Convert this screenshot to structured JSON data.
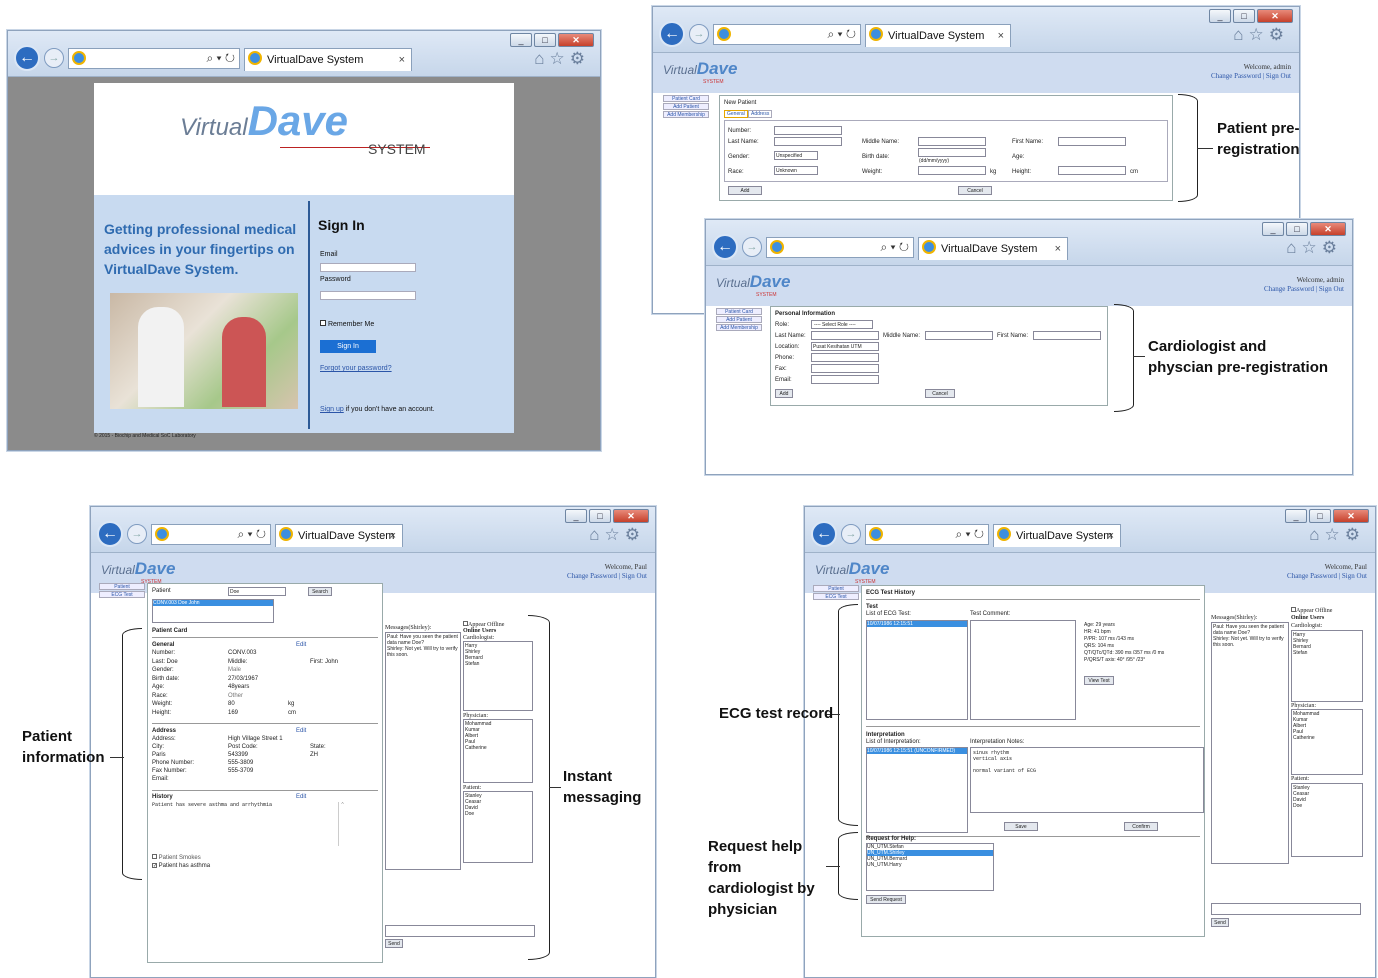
{
  "browser": {
    "tab_title": "VirtualDave System",
    "tab_close": "×",
    "search_glyph": "⌕ ▾ ↻"
  },
  "login": {
    "logo_virtual": "Virtual",
    "logo_dave": "Dave",
    "logo_system": "SYSTEM",
    "tagline": "Getting professional medical advices in your fingertips on VirtualDave System.",
    "signin_title": "Sign In",
    "email_label": "Email",
    "password_label": "Password",
    "remember_label": "Remember Me",
    "signin_button": "Sign In",
    "forgot_link": "Forgot your password?",
    "signup_link": "Sign up",
    "signup_text": "if you don't have an account.",
    "footer": "© 2015 - Biochip and Medical SoC Laboratory"
  },
  "header": {
    "welcome_admin": "Welcome, admin",
    "welcome_paul": "Welcome, Paul",
    "links": "Change Password | Sign Out"
  },
  "patient_reg": {
    "side": [
      "Patient Card",
      "Add Patient",
      "Add Membership"
    ],
    "title": "New Patient",
    "tabs": [
      "General",
      "Address"
    ],
    "number": "Number:",
    "last_name": "Last Name:",
    "middle_name": "Middle Name:",
    "first_name": "First Name:",
    "gender": "Gender:",
    "gender_val": "Unspecified",
    "birth": "Birth date:",
    "birth_hint": "(dd/mm/yyyy)",
    "age": "Age:",
    "race": "Race:",
    "race_val": "Unknown",
    "weight": "Weight:",
    "kg": "kg",
    "height": "Height:",
    "cm": "cm",
    "add": "Add",
    "cancel": "Cancel"
  },
  "doctor_reg": {
    "title": "Personal Information",
    "role": "Role:",
    "role_val": "---- Select Role ----",
    "last_name": "Last Name:",
    "middle_name": "Middle Name:",
    "first_name": "First Name:",
    "location": "Location:",
    "location_val": "Pusat Kesihatan UTM",
    "phone": "Phone:",
    "fax": "Fax:",
    "email": "Email:",
    "add": "Add",
    "cancel": "Cancel"
  },
  "patient_card": {
    "side": [
      "Patient",
      "ECG Test"
    ],
    "patient_label": "Patient",
    "patient_val": "Doe",
    "search": "Search",
    "result": "CONV.003 Doe John",
    "title": "Patient Card",
    "general": "General",
    "edit": "Edit",
    "rows": [
      [
        "Number:",
        "CONV.003"
      ],
      [
        "Last: Doe",
        "Middle:"
      ],
      [
        "Gender:",
        "Male"
      ],
      [
        "Birth date:",
        "27/03/1967"
      ],
      [
        "Age:",
        "48years"
      ],
      [
        "Race:",
        "Other"
      ],
      [
        "Weight:",
        "80"
      ],
      [
        "Height:",
        "169"
      ]
    ],
    "first": "First: John",
    "kg": "kg",
    "cm": "cm",
    "address": "Address",
    "addr_rows": [
      [
        "Address:",
        "High Village Street 1"
      ],
      [
        "City:",
        "Post Code:"
      ],
      [
        "Paris",
        "543399"
      ],
      [
        "Phone Number:",
        "555-3809"
      ],
      [
        "Fax Number:",
        "555-3709"
      ],
      [
        "Email:",
        ""
      ]
    ],
    "state": "State:",
    "state_val": "ZH",
    "history": "History",
    "history_text": "Patient has severe asthma and arrhythmia",
    "smokes": "Patient Smokes",
    "asthma": "Patient has asthma"
  },
  "messaging": {
    "messages_title": "Messages(Shirley):",
    "msg1": "Paul: Have you seen the patient data name Doe?",
    "msg2": "Shirley: Not yet. Will try to verify this soon.",
    "appear_offline": "Appear Offline",
    "online_users": "Online Users",
    "cardiologist": "Cardiologist:",
    "cardiologists": [
      "Harry",
      "Shirley",
      "Bernard",
      "Stefan"
    ],
    "physician": "Physician:",
    "physicians": [
      "Mohammad",
      "Kumar",
      "Albert",
      "Paul",
      "Catherine"
    ],
    "patient": "Patient:",
    "patients": [
      "Stanley",
      "Ceasar",
      "David",
      "Doe"
    ],
    "send": "Send"
  },
  "ecg": {
    "title": "ECG Test History",
    "test": "Test",
    "list_label": "List of ECG Test:",
    "list_item": "10/07/1986 12:15:51",
    "comment_label": "Test Comment:",
    "stats": [
      "Age: 29 years",
      "HR: 41 bpm",
      "P/PR: 107 ms /143 ms",
      "QRS: 104 ms",
      "QT/QTc/QTd: 390 ms /357 ms /0 ms",
      "P/QRS/T axis: 40° /95° /23°"
    ],
    "view_test": "View Test",
    "interpretation": "Interpretation",
    "interp_list_label": "List of Interpretation:",
    "interp_item": "10/07/1986 12:15:51 (UNCONFIRMED)",
    "notes_label": "Interpretation Notes:",
    "notes": [
      "sinus rhythm",
      "vertical axis",
      "",
      "normal variant of ECG"
    ],
    "save": "Save",
    "confirm": "Confirm",
    "help_label": "Request for Help:",
    "help_list": [
      "UN_UTM.Stefan",
      "UN_UTM.Shirley",
      "UN_UTM.Bernard",
      "UN_UTM.Harry"
    ],
    "send_request": "Send Request"
  },
  "annotations": {
    "patient_prereg": "Patient pre-registration",
    "cardio_prereg": "Cardiologist and physcian pre-registration",
    "patient_info": "Patient information",
    "instant_msg": "Instant messaging",
    "ecg_record": "ECG test record",
    "request_help": "Request help from cardiologist by physician"
  }
}
